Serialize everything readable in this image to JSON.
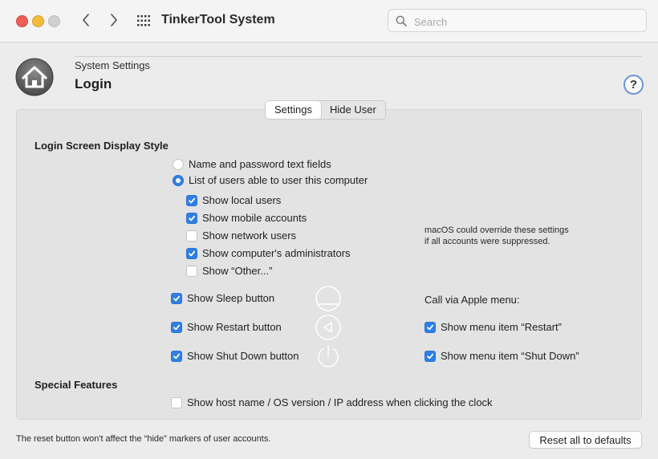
{
  "app": {
    "title": "TinkerTool System"
  },
  "search": {
    "placeholder": "Search"
  },
  "header": {
    "breadcrumb": "System Settings",
    "title": "Login",
    "help": "?"
  },
  "tabs": [
    {
      "label": "Settings",
      "active": true
    },
    {
      "label": "Hide User",
      "active": false
    }
  ],
  "login_style": {
    "title": "Login Screen Display Style",
    "radios": [
      {
        "label": "Name and password text fields",
        "selected": false
      },
      {
        "label": "List of users able to user this computer",
        "selected": true
      }
    ],
    "checkboxes": [
      {
        "label": "Show local users",
        "checked": true
      },
      {
        "label": "Show mobile accounts",
        "checked": true
      },
      {
        "label": "Show network users",
        "checked": false
      },
      {
        "label": "Show computer's administrators",
        "checked": true
      },
      {
        "label": "Show “Other...”",
        "checked": false
      }
    ],
    "note": [
      "macOS could override these settings",
      "if all accounts were suppressed."
    ]
  },
  "power": {
    "sleep": {
      "label": "Show Sleep button",
      "checked": true
    },
    "restart": {
      "label": "Show Restart button",
      "checked": true
    },
    "shutdown": {
      "label": "Show Shut Down button",
      "checked": true
    }
  },
  "apple_menu": {
    "title": "Call via Apple menu:",
    "restart": {
      "label": "Show menu item “Restart”",
      "checked": true
    },
    "shutdown": {
      "label": "Show menu item “Shut Down”",
      "checked": true
    }
  },
  "special": {
    "title": "Special Features",
    "clock": {
      "label": "Show host name / OS version / IP address when clicking the clock",
      "checked": false
    }
  },
  "footer": {
    "note": "The reset button won't affect the “hide” markers of user accounts.",
    "reset_label": "Reset all to defaults"
  },
  "colors": {
    "accent": "#2f7fe5",
    "close": "#ec5f57",
    "minimize": "#f1bc3a",
    "help_ring": "#6c92d8"
  },
  "icons": [
    "back-icon",
    "forward-icon",
    "grid-icon",
    "search-icon",
    "home-icon",
    "sleep-icon",
    "restart-icon",
    "power-icon",
    "checkmark-icon"
  ]
}
